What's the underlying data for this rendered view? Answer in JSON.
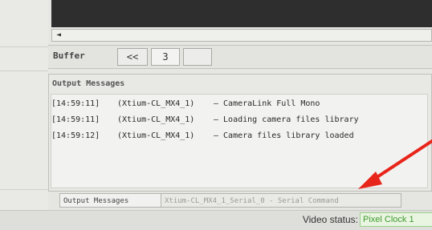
{
  "buffer_bar": {
    "label": "Buffer",
    "prev_label": "<<",
    "current_number": "3"
  },
  "output_panel": {
    "title": "Output Messages",
    "messages": [
      {
        "time": "[14:59:11]",
        "source": "(Xtium-CL_MX4_1)",
        "text": "— CameraLink Full Mono"
      },
      {
        "time": "[14:59:11]",
        "source": "(Xtium-CL_MX4_1)",
        "text": "— Loading camera files library"
      },
      {
        "time": "[14:59:12]",
        "source": "(Xtium-CL_MX4_1)",
        "text": "— Camera files library loaded"
      }
    ]
  },
  "tabs": [
    {
      "label": "Output Messages"
    },
    {
      "label": "Xtium-CL_MX4_1_Serial_0 - Serial Command"
    }
  ],
  "status_bar": {
    "label": "Video status:",
    "value": "Pixel Clock 1"
  },
  "icons": {
    "scroll_left": "◄"
  },
  "colors": {
    "status_green": "#3f9a2e",
    "annotation_arrow": "#e8251a"
  }
}
